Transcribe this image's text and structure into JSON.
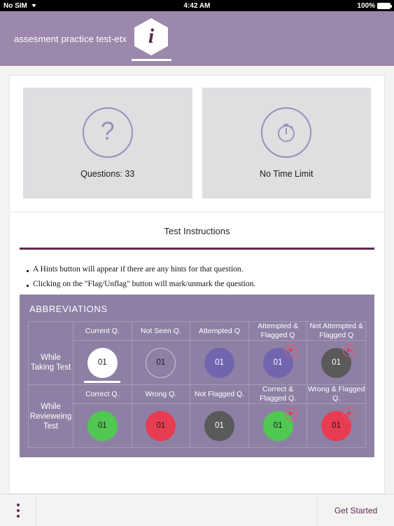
{
  "statusbar": {
    "carrier": "No SIM",
    "wifi_icon": "wifi-icon",
    "time": "4:42 AM",
    "battery_percent": "100%",
    "battery_icon": "battery-full-icon"
  },
  "header": {
    "title": "assesment practice test-etx",
    "info_tab_icon": "info-hexagon-icon",
    "info_glyph": "i",
    "background_color": "#9b88ab"
  },
  "tiles": [
    {
      "icon": "question-mark-circle-icon",
      "glyph": "?",
      "label": "Questions: 33"
    },
    {
      "icon": "stopwatch-circle-icon",
      "glyph": "",
      "label": "No Time Limit"
    }
  ],
  "instructions": {
    "heading": "Test Instructions",
    "rule_color": "#5d2a56",
    "bullets": [
      "A Hints button will appear if there are any hints for that question.",
      "Clicking on the \"Flag/Unflag\" button will mark/unmark the question."
    ]
  },
  "abbreviations": {
    "title": "ABBREVIATIONS",
    "panel_color": "#8d80a4",
    "rows": [
      {
        "row_label": "While Taking Test",
        "cells": [
          {
            "header": "Current Q.",
            "value": "01",
            "style": "b-current",
            "flag": false,
            "current": true
          },
          {
            "header": "Not Seen Q.",
            "value": "01",
            "style": "b-notseen",
            "flag": false,
            "current": false
          },
          {
            "header": "Attempted Q",
            "value": "01",
            "style": "b-attempt",
            "flag": false,
            "current": false
          },
          {
            "header": "Attempted & Flagged Q",
            "value": "01",
            "style": "b-attempt",
            "flag": true,
            "current": false
          },
          {
            "header": "Not Attempted & Flagged Q",
            "value": "01",
            "style": "b-gray",
            "flag": true,
            "current": false
          }
        ]
      },
      {
        "row_label": "While Revieweing Test",
        "cells": [
          {
            "header": "Correct Q.",
            "value": "01",
            "style": "b-green",
            "flag": false,
            "current": false
          },
          {
            "header": "Wrong Q.",
            "value": "01",
            "style": "b-red",
            "flag": false,
            "current": false
          },
          {
            "header": "Not Flagged Q.",
            "value": "01",
            "style": "b-gray",
            "flag": false,
            "current": false
          },
          {
            "header": "Correct & Flagged Q.",
            "value": "01",
            "style": "b-green",
            "flag": true,
            "current": false
          },
          {
            "header": "Wrong & Flagged Q.",
            "value": "01",
            "style": "b-red",
            "flag": true,
            "current": false
          }
        ]
      }
    ]
  },
  "bottombar": {
    "menu_icon": "more-vertical-icon",
    "get_started_label": "Get Started",
    "accent_color": "#5d2a56"
  }
}
